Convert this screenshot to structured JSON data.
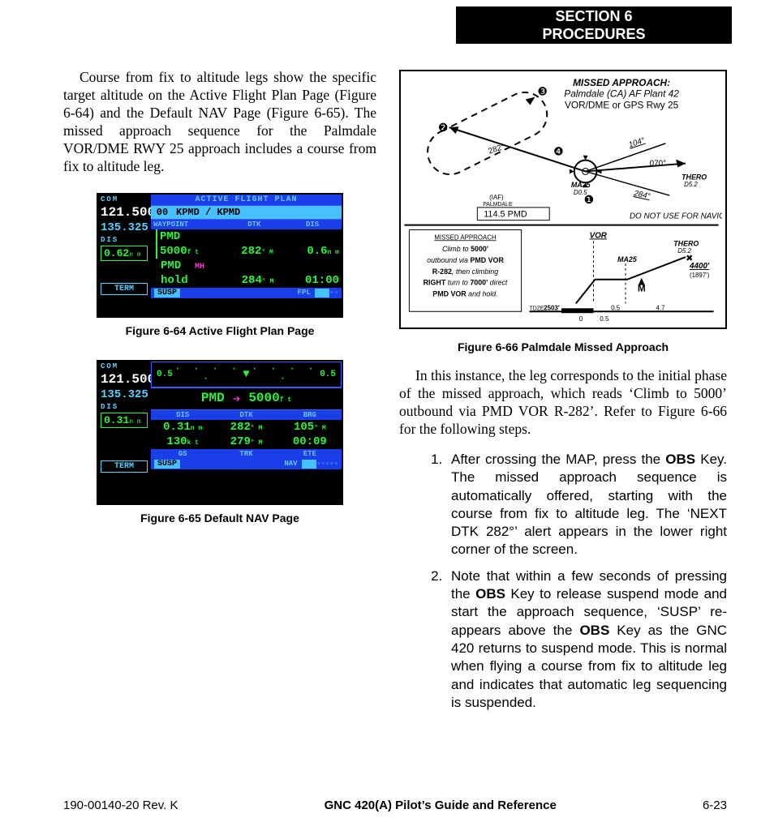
{
  "section": {
    "line1": "SECTION 6",
    "line2": "PROCEDURES"
  },
  "left": {
    "p1": "Course from fix to altitude legs show the specific target altitude on the Active Flight Plan  Page (Figure 6-64) and the Default NAV Page (Figure 6-65).  The missed approach sequence for the Palmdale VOR/DME RWY 25 approach includes a course from fix to altitude leg.",
    "caption64": "Figure 6-64  Active Flight Plan Page",
    "caption65": "Figure 6-65 Default NAV Page"
  },
  "fig64": {
    "com_label": "COM",
    "com_active": "121.500",
    "com_standby": "135.325",
    "title": "ACTIVE FLIGHT PLAN",
    "plan_index": "00",
    "plan_name": "KPMD / KPMD",
    "hdr_waypoint": "WAYPOINT",
    "hdr_dtk": "DTK",
    "hdr_dis": "DIS",
    "dis_label": "DIS",
    "dis_value": "0.62",
    "dis_unit": "n m",
    "term": "TERM",
    "row1_wp": "PMD",
    "row2_wp": "5000",
    "row2_unit": "f t",
    "row2_dtk": "282",
    "row2_dtk_unit": "° M",
    "row2_dis": "0.6",
    "row2_dis_unit": "n m",
    "row3_wp": "PMD",
    "row3_tag": "MH",
    "row4_wp": "hold",
    "row4_dtk": "284",
    "row4_dtk_unit": "° M",
    "row4_time": "01:00",
    "susp": "SUSP",
    "fpl": "FPL"
  },
  "fig65": {
    "com_label": "COM",
    "com_active": "121.500",
    "com_standby": "135.325",
    "cdi_left": "0.5",
    "cdi_right": "0.5",
    "active_wp": "PMD",
    "to_alt": "5000",
    "to_alt_unit": "f t",
    "dis_label": "DIS",
    "dis_value": "0.31",
    "dis_unit": "n m",
    "hdr_dis": "DIS",
    "hdr_dtk": "DTK",
    "hdr_brg": "BRG",
    "row1_dis": "0.31",
    "row1_dis_unit": "n m",
    "row1_dtk": "282",
    "row1_dtk_unit": "° M",
    "row1_brg": "105",
    "row1_brg_unit": "° M",
    "row2_spd": "130",
    "row2_spd_unit": "k t",
    "row2_trk": "279",
    "row2_trk_unit": "° M",
    "row2_ete": "00:09",
    "hdr_gs": "GS",
    "hdr_trk": "TRK",
    "hdr_ete": "ETE",
    "term": "TERM",
    "susp": "SUSP",
    "nav": "NAV"
  },
  "plate": {
    "title1": "MISSED APPROACH:",
    "title2": "Palmdale (CA) AF Plant 42",
    "title3": "VOR/DME or GPS Rwy 25",
    "marker1": "❶",
    "marker2": "❷",
    "marker3": "❸",
    "marker4": "❹",
    "crs282": "282°",
    "crs104": "104°",
    "crs070": "070°",
    "crs284": "284°",
    "ma25": "MA25",
    "ma25_d": "D0.5",
    "thero": "THERO",
    "thero_d": "D5.2",
    "iaf": "(IAF)",
    "iaf_name": "PALMDALE",
    "freq": "114.5  PMD",
    "donotuse": "DO NOT USE FOR NAVIGATION",
    "ma_head": "MISSED APPROACH",
    "ma_l1a": "Climb to ",
    "ma_l1b": "5000'",
    "ma_l2a": "outbound via ",
    "ma_l2b": "PMD VOR",
    "ma_l3a": "R-282",
    "ma_l3b": ", then climbing",
    "ma_l4a": "RIGHT ",
    "ma_l4b": "turn to ",
    "ma_l4c": "7000' ",
    "ma_l4d": "direct",
    "ma_l5a": "PMD VOR ",
    "ma_l5b": "and hold.",
    "vor": "VOR",
    "prof_ma25": "MA25",
    "prof_thero": "THERO",
    "prof_thero_d": "D5.2",
    "alt4400": "4400'",
    "alt1897": "(1897')",
    "tdze": "TDZE ",
    "tdze_v": "2503'",
    "tick0": "0",
    "tick05a": "0.5",
    "tick05b": "0.5",
    "tick47": "4.7",
    "caption": "Figure 6-66  Palmdale Missed Approach"
  },
  "right": {
    "p1": "In this instance, the leg corresponds to the initial phase of the missed approach, which reads ‘Climb to 5000’ outbound via PMD VOR R-282’.  Refer to Figure 6-66 for the following steps.",
    "li1_a": "After crossing the MAP, press the ",
    "li1_key": "OBS",
    "li1_b": " Key.  The missed approach sequence is automatically offered, starting with the course from fix to altitude leg.  The ‘NEXT DTK 282°’ alert appears in the lower right corner of the screen.",
    "li2_a": "Note that within a few seconds of pressing the ",
    "li2_k1": "OBS",
    "li2_b": " Key to release suspend mode and start the approach sequence, ‘SUSP’ re-appears above the ",
    "li2_k2": "OBS",
    "li2_c": " Key as the GNC 420 returns to suspend mode.  This is normal when flying a course from fix to altitude leg and indicates that automatic leg sequencing is suspended."
  },
  "footer": {
    "left": "190-00140-20  Rev. K",
    "center": "GNC 420(A) Pilot’s Guide and Reference",
    "right": "6-23"
  }
}
